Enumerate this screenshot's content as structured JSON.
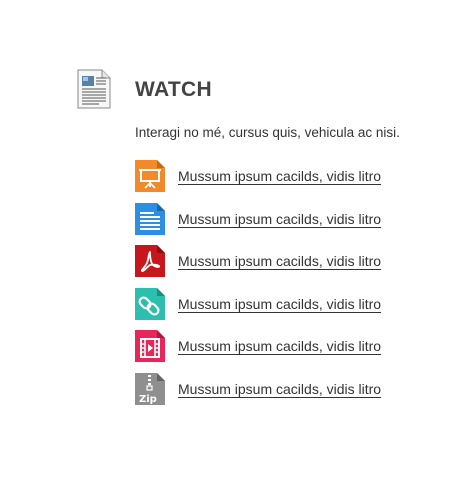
{
  "header": {
    "title": "WATCH",
    "description": "Interagi no mé, cursus quis, vehicula ac nisi.",
    "icon": "document-icon"
  },
  "files": [
    {
      "type": "presentation",
      "icon": "presentation-file-icon",
      "color": "#F18A2B",
      "label": "Mussum ipsum cacilds, vidis litro"
    },
    {
      "type": "document",
      "icon": "text-document-file-icon",
      "color": "#2B8FE4",
      "label": "Mussum ipsum cacilds, vidis litro"
    },
    {
      "type": "pdf",
      "icon": "pdf-file-icon",
      "color": "#C8161D",
      "label": "Mussum ipsum cacilds, vidis litro"
    },
    {
      "type": "link",
      "icon": "link-file-icon",
      "color": "#2DBFAE",
      "label": "Mussum ipsum cacilds, vidis litro"
    },
    {
      "type": "video",
      "icon": "video-file-icon",
      "color": "#E8265A",
      "label": "Mussum ipsum cacilds, vidis litro"
    },
    {
      "type": "zip",
      "icon": "zip-file-icon",
      "color": "#8F8F8F",
      "label": "Mussum ipsum cacilds, vidis litro"
    }
  ]
}
